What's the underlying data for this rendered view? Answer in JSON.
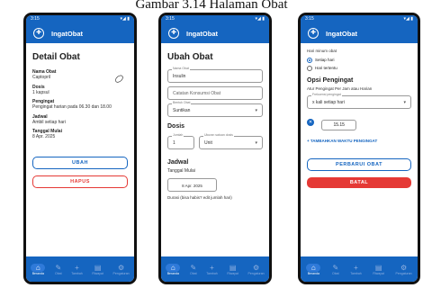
{
  "caption": "Gambar 3.14 Halaman Obat",
  "status": {
    "time": "3:15",
    "signal": "▾◢ ▮"
  },
  "app_title": "IngatObat",
  "screen1": {
    "heading": "Detail Obat",
    "fields": [
      {
        "label": "Nama Obat",
        "value": "Captopril"
      },
      {
        "label": "Dosis",
        "value": "1 kapsul"
      },
      {
        "label": "Pengingat",
        "value": "Pengingat harian pada 06.30 dan 18.00"
      },
      {
        "label": "Jadwal",
        "value": "Ambil setiap hari"
      },
      {
        "label": "Tanggal Mulai",
        "value": "8 Apr. 2025"
      }
    ],
    "edit_button": "UBAH",
    "delete_button": "HAPUS"
  },
  "screen2": {
    "heading": "Ubah Obat",
    "name_label": "Nama Obat",
    "name_value": "Insulin",
    "notes_placeholder": "Catatan Konsumsi Obat",
    "form_label": "Bentuk Obat",
    "form_value": "Suntikan",
    "dose_section": "Dosis",
    "amount_label": "Jumlah",
    "amount_value": "1",
    "unit_label": "Ukuran satuan dosis",
    "unit_value": "Unit",
    "schedule_section": "Jadwal",
    "start_label": "Tanggal Mulai",
    "start_value": "8 Apr. 2025",
    "question": "Durasi (bisa habis? edit jumlah hari)"
  },
  "screen3": {
    "question": "Hari minum obat",
    "option1": "Setiap hari",
    "option2": "Hari tertentu",
    "reminder_section": "Opsi Pengingat",
    "reminder_q": "Atur Pengingat Per Jam atau Harian",
    "freq_label": "Frekuensi pengingat",
    "freq_value": "x kali setiap hari",
    "time_value": "15.15",
    "add_time": "+ TAMBAHKAN WAKTU PENGINGAT",
    "update_button": "PERBARUI OBAT",
    "cancel_button": "BATAL"
  },
  "nav": [
    {
      "label": "Beranda",
      "icon": "⌂"
    },
    {
      "label": "Obat",
      "icon": "✎"
    },
    {
      "label": "Tambah",
      "icon": "+"
    },
    {
      "label": "Riwayat",
      "icon": "▤"
    },
    {
      "label": "Pengaturan",
      "icon": "⚙"
    }
  ]
}
